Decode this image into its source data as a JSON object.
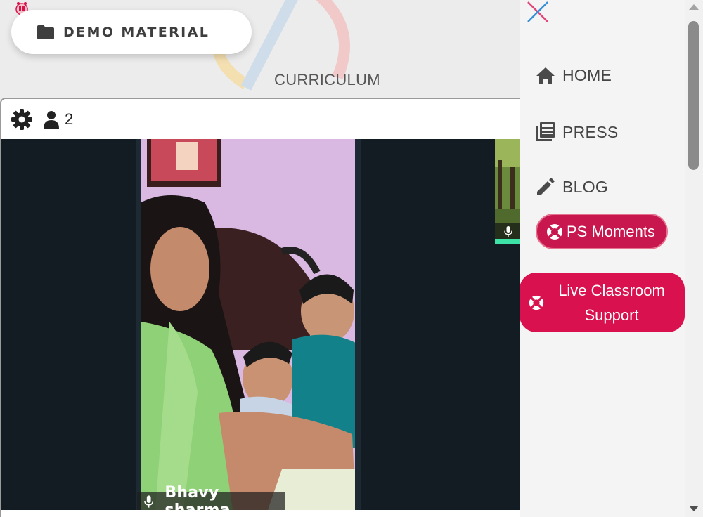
{
  "toolbar": {
    "demo_material_label": "DEMO MATERIAL",
    "curriculum_label": "CURRICULUM"
  },
  "video": {
    "participant_count": "2",
    "participant_name": "Bhavy sharma"
  },
  "sidebar": {
    "items": [
      {
        "label": "HOME",
        "icon": "home-icon"
      },
      {
        "label": "PRESS",
        "icon": "newspaper-icon"
      },
      {
        "label": "BLOG",
        "icon": "pencil-icon"
      }
    ],
    "ps_moments_label": "PS Moments",
    "live_support_label": "Live Classroom Support"
  },
  "colors": {
    "accent": "#d9114f",
    "ps_button": "#c8174f",
    "video_bg": "#131c23",
    "audio_level": "#3de3a6"
  }
}
